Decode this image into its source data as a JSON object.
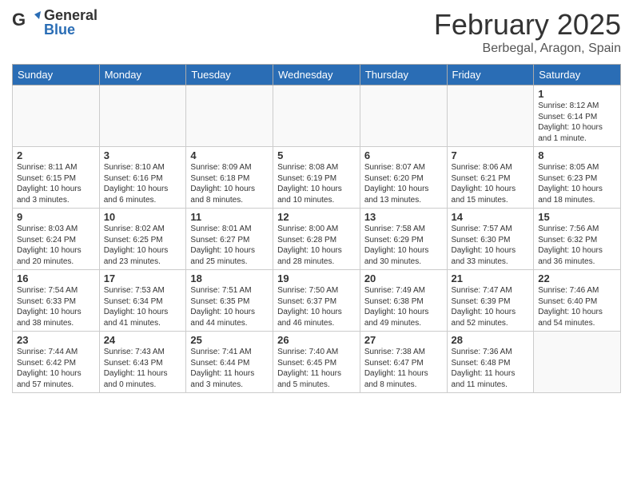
{
  "header": {
    "logo_general": "General",
    "logo_blue": "Blue",
    "month_title": "February 2025",
    "subtitle": "Berbegal, Aragon, Spain"
  },
  "days_of_week": [
    "Sunday",
    "Monday",
    "Tuesday",
    "Wednesday",
    "Thursday",
    "Friday",
    "Saturday"
  ],
  "weeks": [
    [
      {
        "day": "",
        "info": ""
      },
      {
        "day": "",
        "info": ""
      },
      {
        "day": "",
        "info": ""
      },
      {
        "day": "",
        "info": ""
      },
      {
        "day": "",
        "info": ""
      },
      {
        "day": "",
        "info": ""
      },
      {
        "day": "1",
        "info": "Sunrise: 8:12 AM\nSunset: 6:14 PM\nDaylight: 10 hours\nand 1 minute."
      }
    ],
    [
      {
        "day": "2",
        "info": "Sunrise: 8:11 AM\nSunset: 6:15 PM\nDaylight: 10 hours\nand 3 minutes."
      },
      {
        "day": "3",
        "info": "Sunrise: 8:10 AM\nSunset: 6:16 PM\nDaylight: 10 hours\nand 6 minutes."
      },
      {
        "day": "4",
        "info": "Sunrise: 8:09 AM\nSunset: 6:18 PM\nDaylight: 10 hours\nand 8 minutes."
      },
      {
        "day": "5",
        "info": "Sunrise: 8:08 AM\nSunset: 6:19 PM\nDaylight: 10 hours\nand 10 minutes."
      },
      {
        "day": "6",
        "info": "Sunrise: 8:07 AM\nSunset: 6:20 PM\nDaylight: 10 hours\nand 13 minutes."
      },
      {
        "day": "7",
        "info": "Sunrise: 8:06 AM\nSunset: 6:21 PM\nDaylight: 10 hours\nand 15 minutes."
      },
      {
        "day": "8",
        "info": "Sunrise: 8:05 AM\nSunset: 6:23 PM\nDaylight: 10 hours\nand 18 minutes."
      }
    ],
    [
      {
        "day": "9",
        "info": "Sunrise: 8:03 AM\nSunset: 6:24 PM\nDaylight: 10 hours\nand 20 minutes."
      },
      {
        "day": "10",
        "info": "Sunrise: 8:02 AM\nSunset: 6:25 PM\nDaylight: 10 hours\nand 23 minutes."
      },
      {
        "day": "11",
        "info": "Sunrise: 8:01 AM\nSunset: 6:27 PM\nDaylight: 10 hours\nand 25 minutes."
      },
      {
        "day": "12",
        "info": "Sunrise: 8:00 AM\nSunset: 6:28 PM\nDaylight: 10 hours\nand 28 minutes."
      },
      {
        "day": "13",
        "info": "Sunrise: 7:58 AM\nSunset: 6:29 PM\nDaylight: 10 hours\nand 30 minutes."
      },
      {
        "day": "14",
        "info": "Sunrise: 7:57 AM\nSunset: 6:30 PM\nDaylight: 10 hours\nand 33 minutes."
      },
      {
        "day": "15",
        "info": "Sunrise: 7:56 AM\nSunset: 6:32 PM\nDaylight: 10 hours\nand 36 minutes."
      }
    ],
    [
      {
        "day": "16",
        "info": "Sunrise: 7:54 AM\nSunset: 6:33 PM\nDaylight: 10 hours\nand 38 minutes."
      },
      {
        "day": "17",
        "info": "Sunrise: 7:53 AM\nSunset: 6:34 PM\nDaylight: 10 hours\nand 41 minutes."
      },
      {
        "day": "18",
        "info": "Sunrise: 7:51 AM\nSunset: 6:35 PM\nDaylight: 10 hours\nand 44 minutes."
      },
      {
        "day": "19",
        "info": "Sunrise: 7:50 AM\nSunset: 6:37 PM\nDaylight: 10 hours\nand 46 minutes."
      },
      {
        "day": "20",
        "info": "Sunrise: 7:49 AM\nSunset: 6:38 PM\nDaylight: 10 hours\nand 49 minutes."
      },
      {
        "day": "21",
        "info": "Sunrise: 7:47 AM\nSunset: 6:39 PM\nDaylight: 10 hours\nand 52 minutes."
      },
      {
        "day": "22",
        "info": "Sunrise: 7:46 AM\nSunset: 6:40 PM\nDaylight: 10 hours\nand 54 minutes."
      }
    ],
    [
      {
        "day": "23",
        "info": "Sunrise: 7:44 AM\nSunset: 6:42 PM\nDaylight: 10 hours\nand 57 minutes."
      },
      {
        "day": "24",
        "info": "Sunrise: 7:43 AM\nSunset: 6:43 PM\nDaylight: 11 hours\nand 0 minutes."
      },
      {
        "day": "25",
        "info": "Sunrise: 7:41 AM\nSunset: 6:44 PM\nDaylight: 11 hours\nand 3 minutes."
      },
      {
        "day": "26",
        "info": "Sunrise: 7:40 AM\nSunset: 6:45 PM\nDaylight: 11 hours\nand 5 minutes."
      },
      {
        "day": "27",
        "info": "Sunrise: 7:38 AM\nSunset: 6:47 PM\nDaylight: 11 hours\nand 8 minutes."
      },
      {
        "day": "28",
        "info": "Sunrise: 7:36 AM\nSunset: 6:48 PM\nDaylight: 11 hours\nand 11 minutes."
      },
      {
        "day": "",
        "info": ""
      }
    ]
  ]
}
